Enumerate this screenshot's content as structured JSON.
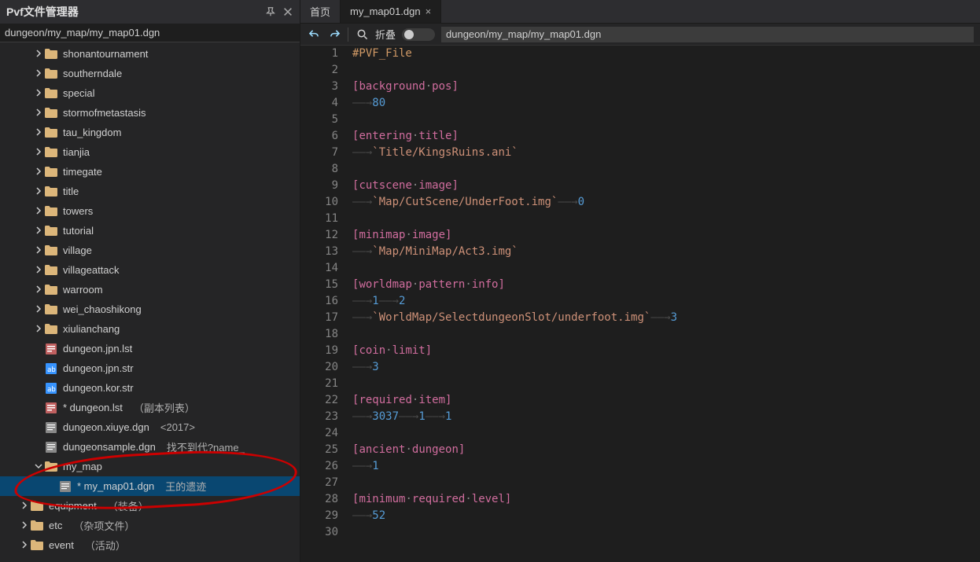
{
  "panel": {
    "title": "Pvf文件管理器",
    "path": "dungeon/my_map/my_map01.dgn"
  },
  "tree": [
    {
      "depth": 2,
      "kind": "folder",
      "expandable": true,
      "open": false,
      "label": "shonantournament"
    },
    {
      "depth": 2,
      "kind": "folder",
      "expandable": true,
      "open": false,
      "label": "southerndale"
    },
    {
      "depth": 2,
      "kind": "folder",
      "expandable": true,
      "open": false,
      "label": "special"
    },
    {
      "depth": 2,
      "kind": "folder",
      "expandable": true,
      "open": false,
      "label": "stormofmetastasis"
    },
    {
      "depth": 2,
      "kind": "folder",
      "expandable": true,
      "open": false,
      "label": "tau_kingdom"
    },
    {
      "depth": 2,
      "kind": "folder",
      "expandable": true,
      "open": false,
      "label": "tianjia"
    },
    {
      "depth": 2,
      "kind": "folder",
      "expandable": true,
      "open": false,
      "label": "timegate"
    },
    {
      "depth": 2,
      "kind": "folder",
      "expandable": true,
      "open": false,
      "label": "title"
    },
    {
      "depth": 2,
      "kind": "folder",
      "expandable": true,
      "open": false,
      "label": "towers"
    },
    {
      "depth": 2,
      "kind": "folder",
      "expandable": true,
      "open": false,
      "label": "tutorial"
    },
    {
      "depth": 2,
      "kind": "folder",
      "expandable": true,
      "open": false,
      "label": "village"
    },
    {
      "depth": 2,
      "kind": "folder",
      "expandable": true,
      "open": false,
      "label": "villageattack"
    },
    {
      "depth": 2,
      "kind": "folder",
      "expandable": true,
      "open": false,
      "label": "warroom"
    },
    {
      "depth": 2,
      "kind": "folder",
      "expandable": true,
      "open": false,
      "label": "wei_chaoshikong"
    },
    {
      "depth": 2,
      "kind": "folder",
      "expandable": true,
      "open": false,
      "label": "xiulianchang"
    },
    {
      "depth": 2,
      "kind": "lst",
      "expandable": false,
      "label": "dungeon.jpn.lst"
    },
    {
      "depth": 2,
      "kind": "str",
      "expandable": false,
      "label": "dungeon.jpn.str"
    },
    {
      "depth": 2,
      "kind": "str",
      "expandable": false,
      "label": "dungeon.kor.str"
    },
    {
      "depth": 2,
      "kind": "lst",
      "expandable": false,
      "label": "* dungeon.lst",
      "extra": "（副本列表）"
    },
    {
      "depth": 2,
      "kind": "dgn",
      "expandable": false,
      "label": "dungeon.xiuye.dgn",
      "extra": "<2017>"
    },
    {
      "depth": 2,
      "kind": "dgn",
      "expandable": false,
      "label": "dungeonsample.dgn",
      "extra": "找不到代?name_"
    },
    {
      "depth": 2,
      "kind": "folder",
      "expandable": true,
      "open": true,
      "label": "my_map"
    },
    {
      "depth": 3,
      "kind": "dgn",
      "expandable": false,
      "label": "* my_map01.dgn",
      "extra": "王的遗迹",
      "selected": true
    },
    {
      "depth": 1,
      "kind": "folder",
      "expandable": true,
      "open": false,
      "label": "equipment",
      "extra": "（装备）"
    },
    {
      "depth": 1,
      "kind": "folder",
      "expandable": true,
      "open": false,
      "label": "etc",
      "extra": "（杂项文件）"
    },
    {
      "depth": 1,
      "kind": "folder",
      "expandable": true,
      "open": false,
      "label": "event",
      "extra": "（活动）"
    }
  ],
  "tabs": [
    {
      "label": "首页",
      "active": false,
      "closable": false
    },
    {
      "label": "my_map01.dgn",
      "active": true,
      "closable": true
    }
  ],
  "toolbar": {
    "fold_label": "折叠",
    "path": "dungeon/my_map/my_map01.dgn"
  },
  "code": [
    {
      "n": 1,
      "t": [
        [
          "pre",
          "#PVF_File"
        ]
      ]
    },
    {
      "n": 2,
      "t": []
    },
    {
      "n": 3,
      "t": [
        [
          "br",
          "["
        ],
        [
          "br",
          "background"
        ],
        [
          "dot",
          "·"
        ],
        [
          "br",
          "pos"
        ],
        [
          "br",
          "]"
        ]
      ]
    },
    {
      "n": 4,
      "t": [
        [
          "ws",
          "——→"
        ],
        [
          "num",
          "80"
        ]
      ]
    },
    {
      "n": 5,
      "t": []
    },
    {
      "n": 6,
      "t": [
        [
          "br",
          "["
        ],
        [
          "br",
          "entering"
        ],
        [
          "dot",
          "·"
        ],
        [
          "br",
          "title"
        ],
        [
          "br",
          "]"
        ]
      ]
    },
    {
      "n": 7,
      "t": [
        [
          "ws",
          "——→"
        ],
        [
          "str",
          "`Title/KingsRuins.ani`"
        ]
      ]
    },
    {
      "n": 8,
      "t": []
    },
    {
      "n": 9,
      "t": [
        [
          "br",
          "["
        ],
        [
          "br",
          "cutscene"
        ],
        [
          "dot",
          "·"
        ],
        [
          "br",
          "image"
        ],
        [
          "br",
          "]"
        ]
      ]
    },
    {
      "n": 10,
      "t": [
        [
          "ws",
          "——→"
        ],
        [
          "str",
          "`Map/CutScene/UnderFoot.img`"
        ],
        [
          "ws",
          "——→"
        ],
        [
          "num",
          "0"
        ]
      ]
    },
    {
      "n": 11,
      "t": []
    },
    {
      "n": 12,
      "t": [
        [
          "br",
          "["
        ],
        [
          "br",
          "minimap"
        ],
        [
          "dot",
          "·"
        ],
        [
          "br",
          "image"
        ],
        [
          "br",
          "]"
        ]
      ]
    },
    {
      "n": 13,
      "t": [
        [
          "ws",
          "——→"
        ],
        [
          "str",
          "`Map/MiniMap/Act3.img`"
        ]
      ]
    },
    {
      "n": 14,
      "t": []
    },
    {
      "n": 15,
      "t": [
        [
          "br",
          "["
        ],
        [
          "br",
          "worldmap"
        ],
        [
          "dot",
          "·"
        ],
        [
          "br",
          "pattern"
        ],
        [
          "dot",
          "·"
        ],
        [
          "br",
          "info"
        ],
        [
          "br",
          "]"
        ]
      ]
    },
    {
      "n": 16,
      "t": [
        [
          "ws",
          "——→"
        ],
        [
          "num",
          "1"
        ],
        [
          "ws",
          "——→"
        ],
        [
          "num",
          "2"
        ]
      ]
    },
    {
      "n": 17,
      "t": [
        [
          "ws",
          "——→"
        ],
        [
          "str",
          "`WorldMap/SelectdungeonSlot/underfoot.img`"
        ],
        [
          "ws",
          "——→"
        ],
        [
          "num",
          "3"
        ]
      ]
    },
    {
      "n": 18,
      "t": []
    },
    {
      "n": 19,
      "t": [
        [
          "br",
          "["
        ],
        [
          "br",
          "coin"
        ],
        [
          "dot",
          "·"
        ],
        [
          "br",
          "limit"
        ],
        [
          "br",
          "]"
        ]
      ]
    },
    {
      "n": 20,
      "t": [
        [
          "ws",
          "——→"
        ],
        [
          "num",
          "3"
        ]
      ]
    },
    {
      "n": 21,
      "t": []
    },
    {
      "n": 22,
      "t": [
        [
          "br",
          "["
        ],
        [
          "br",
          "required"
        ],
        [
          "dot",
          "·"
        ],
        [
          "br",
          "item"
        ],
        [
          "br",
          "]"
        ]
      ]
    },
    {
      "n": 23,
      "t": [
        [
          "ws",
          "——→"
        ],
        [
          "num",
          "3037"
        ],
        [
          "ws",
          "——→"
        ],
        [
          "num",
          "1"
        ],
        [
          "ws",
          "——→"
        ],
        [
          "num",
          "1"
        ]
      ]
    },
    {
      "n": 24,
      "t": []
    },
    {
      "n": 25,
      "t": [
        [
          "br",
          "["
        ],
        [
          "br",
          "ancient"
        ],
        [
          "dot",
          "·"
        ],
        [
          "br",
          "dungeon"
        ],
        [
          "br",
          "]"
        ]
      ]
    },
    {
      "n": 26,
      "t": [
        [
          "ws",
          "——→"
        ],
        [
          "num",
          "1"
        ]
      ]
    },
    {
      "n": 27,
      "t": []
    },
    {
      "n": 28,
      "t": [
        [
          "br",
          "["
        ],
        [
          "br",
          "minimum"
        ],
        [
          "dot",
          "·"
        ],
        [
          "br",
          "required"
        ],
        [
          "dot",
          "·"
        ],
        [
          "br",
          "level"
        ],
        [
          "br",
          "]"
        ]
      ]
    },
    {
      "n": 29,
      "t": [
        [
          "ws",
          "——→"
        ],
        [
          "num",
          "52"
        ]
      ]
    },
    {
      "n": 30,
      "t": []
    }
  ],
  "colors": {
    "accent": "#569cd6",
    "tag": "#d16d9e"
  }
}
